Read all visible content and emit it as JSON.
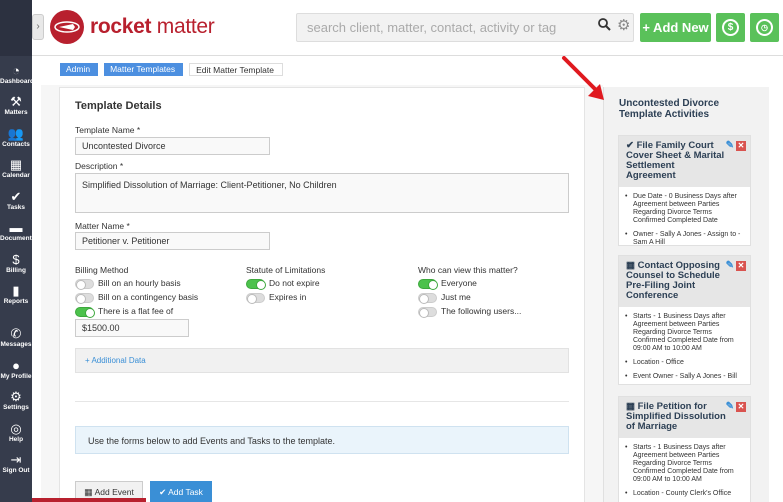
{
  "app": {
    "logo_brand": "rocket",
    "logo_word": "matter"
  },
  "search": {
    "placeholder": "search client, matter, contact, activity or tag"
  },
  "topbar": {
    "add_new_label": "+ Add New",
    "billing_btn_icon": "dollar-icon",
    "timer_btn_icon": "clock-icon"
  },
  "sidebar": {
    "items": [
      {
        "label": "Dashboard",
        "icon": "gauge-icon"
      },
      {
        "label": "Matters",
        "icon": "gavel-icon"
      },
      {
        "label": "Contacts",
        "icon": "people-icon"
      },
      {
        "label": "Calendar",
        "icon": "calendar-icon"
      },
      {
        "label": "Tasks",
        "icon": "check-icon"
      },
      {
        "label": "Documents",
        "icon": "folder-icon"
      },
      {
        "label": "Billing",
        "icon": "dollar-icon"
      },
      {
        "label": "Reports",
        "icon": "bar-chart-icon"
      },
      {
        "label": "Messages",
        "icon": "phone-icon"
      },
      {
        "label": "My Profile",
        "icon": "user-icon"
      },
      {
        "label": "Settings",
        "icon": "gear-icon"
      },
      {
        "label": "Help",
        "icon": "lifebuoy-icon"
      },
      {
        "label": "Sign Out",
        "icon": "sign-out-icon"
      }
    ]
  },
  "breadcrumb": [
    "Admin",
    "Matter Templates",
    "Edit Matter Template"
  ],
  "form": {
    "section_title": "Template Details",
    "template_name_label": "Template Name *",
    "template_name_value": "Uncontested Divorce",
    "description_label": "Description *",
    "description_value": "Simplified Dissolution of Marriage:  Client-Petitioner, No Children",
    "matter_name_label": "Matter Name *",
    "matter_name_value": "Petitioner v. Petitioner",
    "billing_method_label": "Billing Method",
    "billing_options": [
      {
        "label": "Bill on an hourly basis",
        "on": false
      },
      {
        "label": "Bill on a contingency basis",
        "on": false
      },
      {
        "label": "There is a flat fee of",
        "on": true
      }
    ],
    "flat_fee_value": "$1500.00",
    "statute_label": "Statute of Limitations",
    "statute_options": [
      {
        "label": "Do not expire",
        "on": true
      },
      {
        "label": "Expires in",
        "on": false
      }
    ],
    "visibility_label": "Who can view this matter?",
    "visibility_options": [
      {
        "label": "Everyone",
        "on": true
      },
      {
        "label": "Just me",
        "on": false
      },
      {
        "label": "The following users...",
        "on": false
      }
    ],
    "additional_data_label": "+ Additional Data",
    "info_text": "Use the forms below to add Events and Tasks to the template.",
    "add_event_label": "Add Event",
    "add_task_label": "Add Task"
  },
  "activities": {
    "title": "Uncontested Divorce Template Activities",
    "cards": [
      {
        "icon": "check-icon",
        "title": "File Family Court Cover Sheet & Marital Settlement Agreement",
        "items": [
          "Due Date - 0 Business Days after Agreement between Parties Regarding Divorce Terms Confirmed Completed Date",
          "Owner - Sally A Jones - Assign to - Sam A Hill"
        ]
      },
      {
        "icon": "calendar-icon",
        "title": "Contact Opposing Counsel to Schedule Pre-Filing Joint Conference",
        "items": [
          "Starts - 1 Business Days after Agreement between Parties Regarding Divorce Terms Confirmed Completed Date from 09:00 AM to 10:00 AM",
          "Location - Office",
          "Event Owner - Sally A Jones - Bill"
        ]
      },
      {
        "icon": "calendar-icon",
        "title": "File Petition for Simplified Dissolution of Marriage",
        "items": [
          "Starts - 1 Business Days after Agreement between Parties Regarding Divorce Terms Confirmed Completed Date from 09:00 AM to 10:00 AM",
          "Location - County Clerk's Office"
        ]
      }
    ]
  },
  "colors": {
    "brand": "#b8202e",
    "accent_green": "#5ac15a",
    "link_blue": "#3a8fd6",
    "sidebar": "#363c4c"
  }
}
